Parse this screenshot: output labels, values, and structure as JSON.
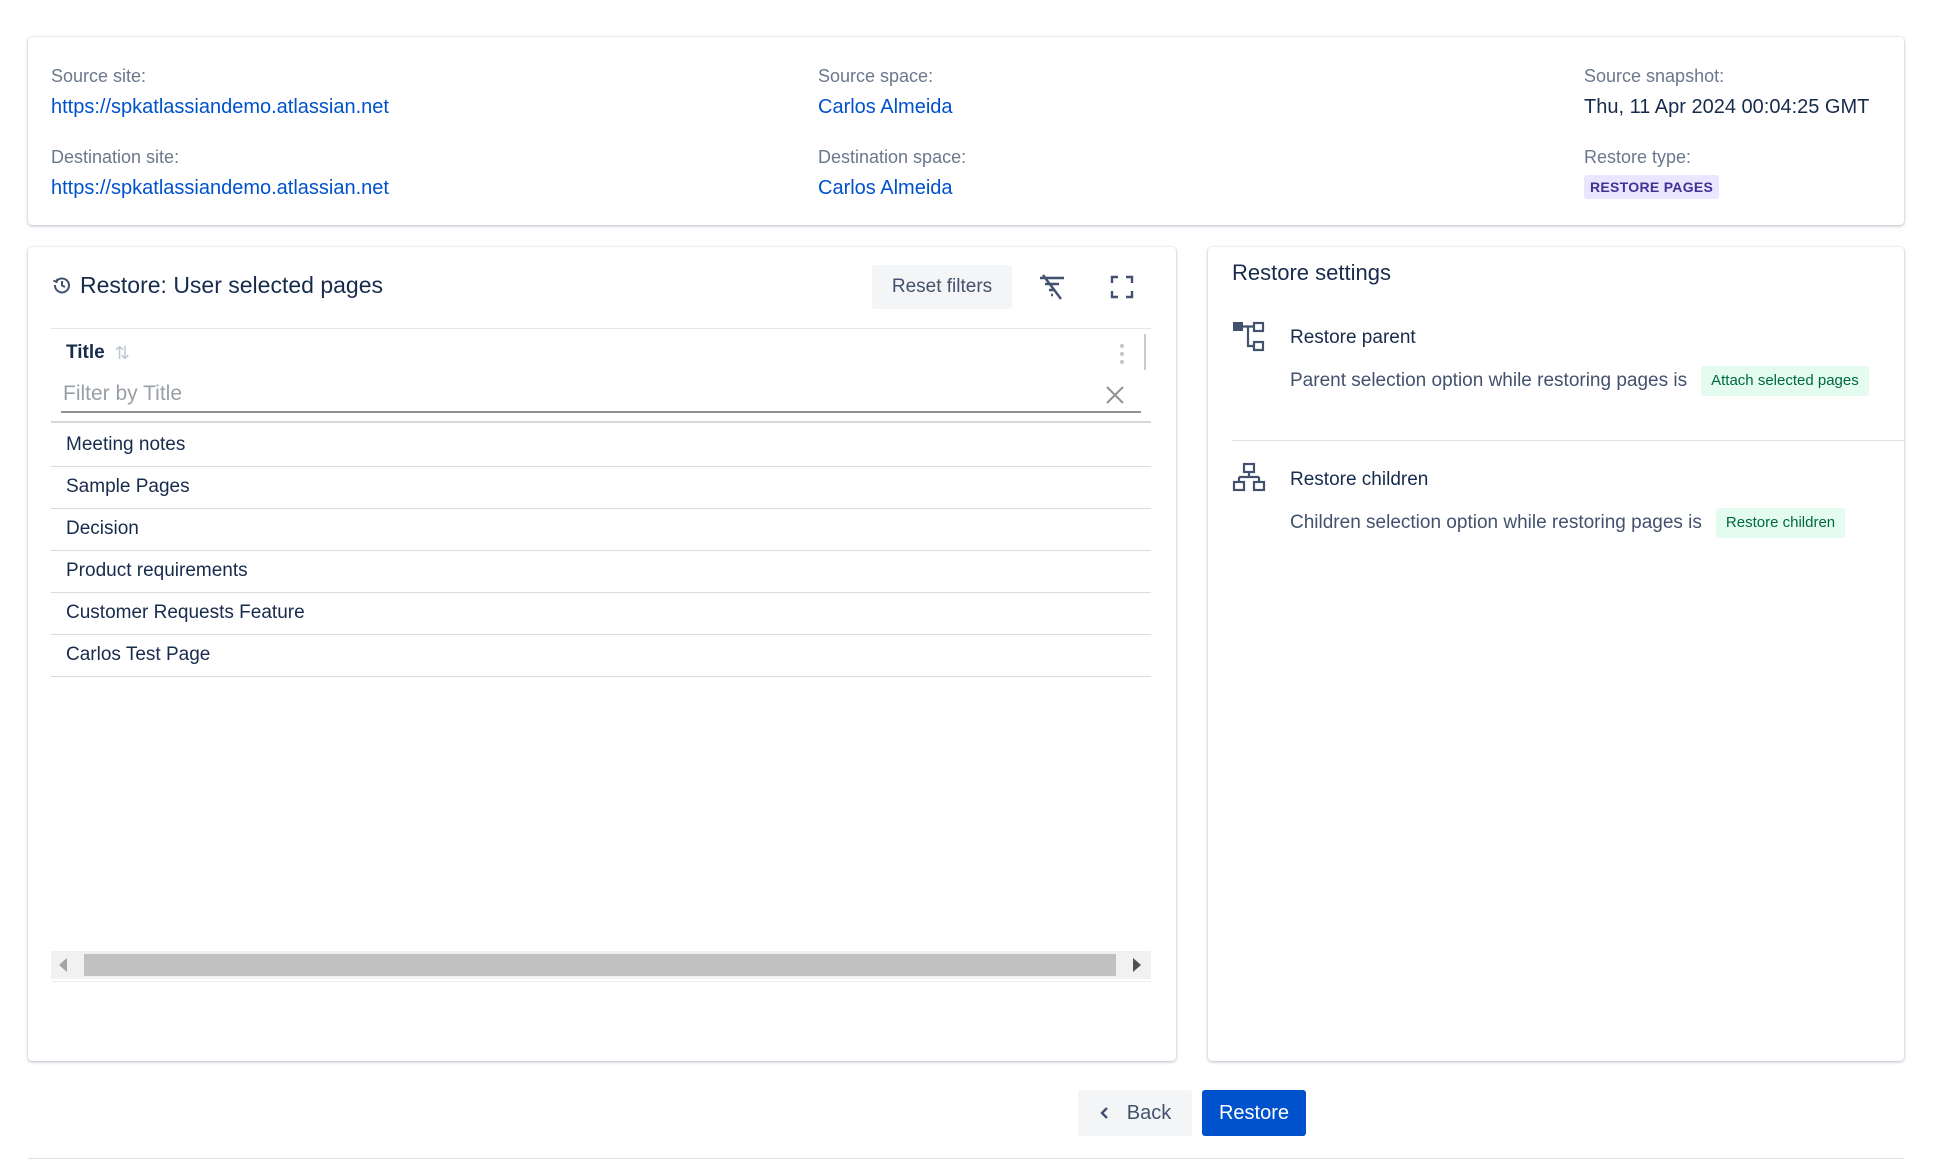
{
  "summary": {
    "source_site_label": "Source site:",
    "source_site_value": "https://spkatlassiandemo.atlassian.net",
    "source_space_label": "Source space:",
    "source_space_value": "Carlos Almeida",
    "source_snapshot_label": "Source snapshot:",
    "source_snapshot_value": "Thu, 11 Apr 2024 00:04:25 GMT",
    "destination_site_label": "Destination site:",
    "destination_site_value": "https://spkatlassiandemo.atlassian.net",
    "destination_space_label": "Destination space:",
    "destination_space_value": "Carlos Almeida",
    "restore_type_label": "Restore type:",
    "restore_type_value": "RESTORE PAGES"
  },
  "left_panel": {
    "title": "Restore: User selected pages",
    "reset_filters_label": "Reset filters",
    "icons": [
      "history-icon",
      "filter-off-icon",
      "fullscreen-icon",
      "sort-icon",
      "kebab-icon",
      "clear-icon"
    ],
    "grid": {
      "column_title": "Title",
      "filter_placeholder": "Filter by Title",
      "rows": [
        "Meeting notes",
        "Sample Pages",
        "Decision",
        "Product requirements",
        "Customer Requests Feature",
        "Carlos Test Page"
      ]
    }
  },
  "right_panel": {
    "title": "Restore settings",
    "settings": [
      {
        "title": "Restore parent",
        "description": "Parent selection option while restoring pages is",
        "tag": "Attach selected pages",
        "icon": "hierarchy-parent-icon"
      },
      {
        "title": "Restore children",
        "description": "Children selection option while restoring pages is",
        "tag": "Restore children",
        "icon": "hierarchy-children-icon"
      }
    ]
  },
  "footer": {
    "back_label": "Back",
    "restore_label": "Restore"
  },
  "colors": {
    "link": "#0052cc",
    "primary_button": "#0052cc",
    "lozenge_bg": "#eae6ff",
    "lozenge_text": "#403294",
    "green_tag_bg": "#e3fcef",
    "green_tag_text": "#006644"
  }
}
